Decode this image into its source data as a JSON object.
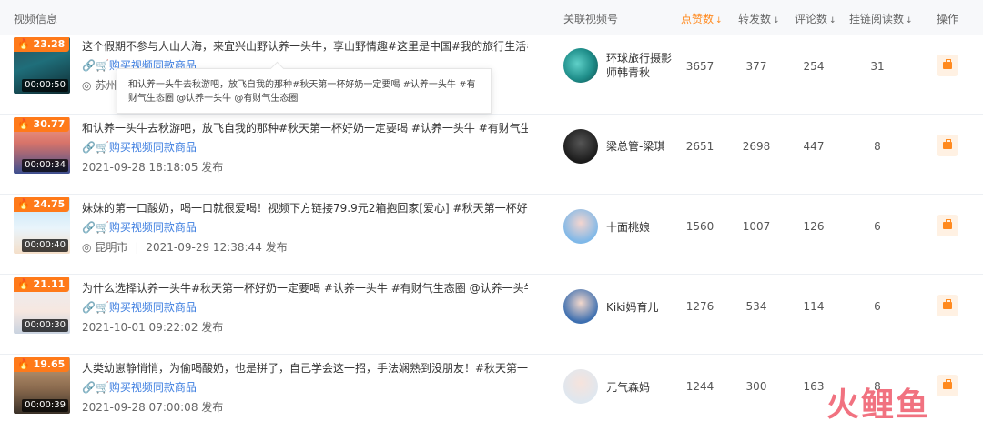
{
  "header": {
    "video_info": "视频信息",
    "linked_account": "关联视频号",
    "likes": "点赞数",
    "shares": "转发数",
    "comments": "评论数",
    "link_reads": "挂链阅读数",
    "actions": "操作",
    "sort_arrow": "↓"
  },
  "buy_label": "购买视频同款商品",
  "publish_suffix": "发布",
  "tooltip_text": "和认养一头牛去秋游吧，放飞自我的那种#秋天第一杯好奶一定要喝 #认养一头牛 #有财气生态圈 @认养一头牛 @有财气生态圈",
  "watermark": "火鲤鱼",
  "rows": [
    {
      "heat": "23.28",
      "duration": "00:00:50",
      "title": "这个假期不参与人山人海，来宜兴山野认养一头牛，享山野情趣#这里是中国#我的旅行生活#认养...",
      "location": "苏州",
      "publish_time": "",
      "account": "环球旅行摄影师韩青秋",
      "likes": "3657",
      "shares": "377",
      "comments": "254",
      "reads": "31"
    },
    {
      "heat": "30.77",
      "duration": "00:00:34",
      "title": "和认养一头牛去秋游吧，放飞自我的那种#秋天第一杯好奶一定要喝 #认养一头牛 #有财气生态圈@...",
      "location": "",
      "publish_time": "2021-09-28 18:18:05",
      "account": "梁总管-梁琪",
      "likes": "2651",
      "shares": "2698",
      "comments": "447",
      "reads": "8"
    },
    {
      "heat": "24.75",
      "duration": "00:00:40",
      "title": "妹妹的第一口酸奶，喝一口就很爱喝！视频下方链接79.9元2箱抱回家[爱心] #秋天第一杯好奶一定...",
      "location": "昆明市",
      "publish_time": "2021-09-29 12:38:44",
      "account": "十面桃娘",
      "likes": "1560",
      "shares": "1007",
      "comments": "126",
      "reads": "6"
    },
    {
      "heat": "21.11",
      "duration": "00:00:30",
      "title": "为什么选择认养一头牛#秋天第一杯好奶一定要喝 #认养一头牛 #有财气生态圈 @认养一头牛 @有...",
      "location": "",
      "publish_time": "2021-10-01 09:22:02",
      "account": "Kiki妈育儿",
      "likes": "1276",
      "shares": "534",
      "comments": "114",
      "reads": "6"
    },
    {
      "heat": "19.65",
      "duration": "00:00:39",
      "title": "人类幼崽静悄悄，为偷喝酸奶，也是拼了，自己学会这一招，手法娴熟到没朋友！#秋天第一杯好奶...",
      "location": "",
      "publish_time": "2021-09-28 07:00:08",
      "account": "元气森妈",
      "likes": "1244",
      "shares": "300",
      "comments": "163",
      "reads": "8"
    }
  ],
  "colors": {
    "accent": "#ff8a1f",
    "link": "#3f7fe0",
    "heat_badge": "#ff7a1a"
  }
}
